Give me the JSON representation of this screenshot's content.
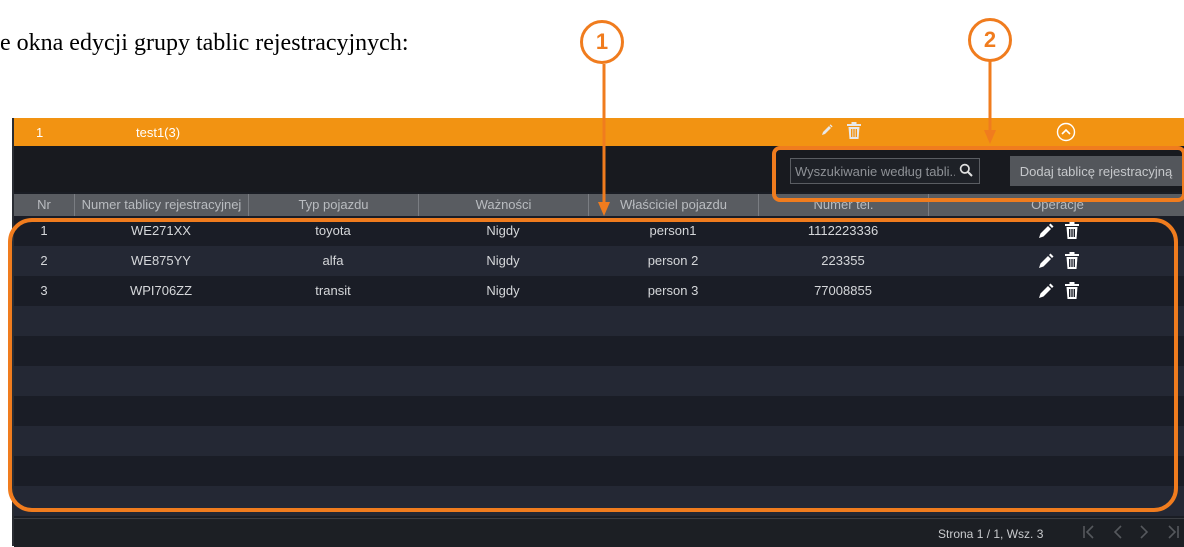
{
  "caption": "e okna edycji grupy tablic rejestracyjnych:",
  "markers": [
    "1",
    "2"
  ],
  "colors": {
    "accent": "#f29312",
    "annotation": "#f07c1e",
    "background": "#1a1d24"
  },
  "group": {
    "number": "1",
    "name": "test1(3)",
    "icons": [
      "pencil-icon",
      "trash-icon",
      "collapse-chevron-icon"
    ]
  },
  "search": {
    "placeholder": "Wyszukiwanie według tabli..."
  },
  "add_button": {
    "label": "Dodaj tablicę rejestracyjną"
  },
  "table": {
    "headers": [
      "Nr",
      "Numer tablicy rejestracyjnej",
      "Typ pojazdu",
      "Ważności",
      "Właściciel pojazdu",
      "Numer tel.",
      "Operacje"
    ],
    "rows": [
      {
        "nr": "1",
        "plate": "WE271XX",
        "type": "toyota",
        "validity": "Nigdy",
        "owner": "person1",
        "phone": "1112223336"
      },
      {
        "nr": "2",
        "plate": "WE875YY",
        "type": "alfa",
        "validity": "Nigdy",
        "owner": "person 2",
        "phone": "223355"
      },
      {
        "nr": "3",
        "plate": "WPI706ZZ",
        "type": "transit",
        "validity": "Nigdy",
        "owner": "person 3",
        "phone": "77008855"
      }
    ],
    "row_icons": [
      "pencil-icon",
      "trash-icon"
    ]
  },
  "pagination": {
    "info": "Strona 1 / 1, Wsz. 3",
    "icons": [
      "first-page-icon",
      "prev-page-icon",
      "next-page-icon",
      "last-page-icon"
    ]
  }
}
